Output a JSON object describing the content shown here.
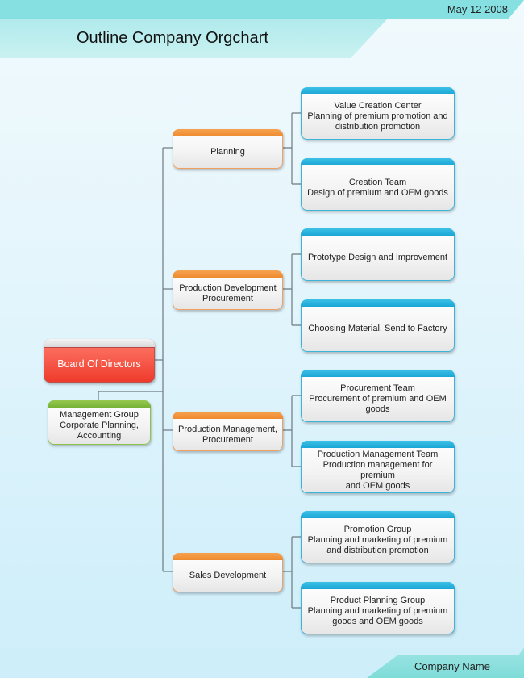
{
  "header": {
    "date": "May 12 2008",
    "title": "Outline Company Orgchart"
  },
  "footer": {
    "company": "Company Name"
  },
  "colors": {
    "board": "#ee3b2c",
    "department": "#ee8a2e",
    "team": "#1aa6d6",
    "support": "#76b236",
    "connector": "#6e7a80"
  },
  "root": {
    "label": "Board Of Directors"
  },
  "support": {
    "label": "Management Group\nCorporate Planning,\nAccounting"
  },
  "departments": [
    {
      "label": "Planning",
      "teams": [
        {
          "label": "Value Creation Center\nPlanning of premium promotion and\ndistribution promotion"
        },
        {
          "label": "Creation Team\nDesign of premium and OEM goods"
        }
      ]
    },
    {
      "label": "Production Development\nProcurement",
      "teams": [
        {
          "label": "Prototype Design and Improvement"
        },
        {
          "label": "Choosing Material, Send to Factory"
        }
      ]
    },
    {
      "label": "Production Management,\nProcurement",
      "teams": [
        {
          "label": "Procurement Team\nProcurement of premium and OEM\ngoods"
        },
        {
          "label": "Production Management Team\nProduction management for premium\nand OEM goods"
        }
      ]
    },
    {
      "label": "Sales Development",
      "teams": [
        {
          "label": "Promotion Group\nPlanning and marketing of premium\nand distribution promotion"
        },
        {
          "label": "Product Planning Group\nPlanning and marketing of premium\ngoods and OEM goods"
        }
      ]
    }
  ]
}
